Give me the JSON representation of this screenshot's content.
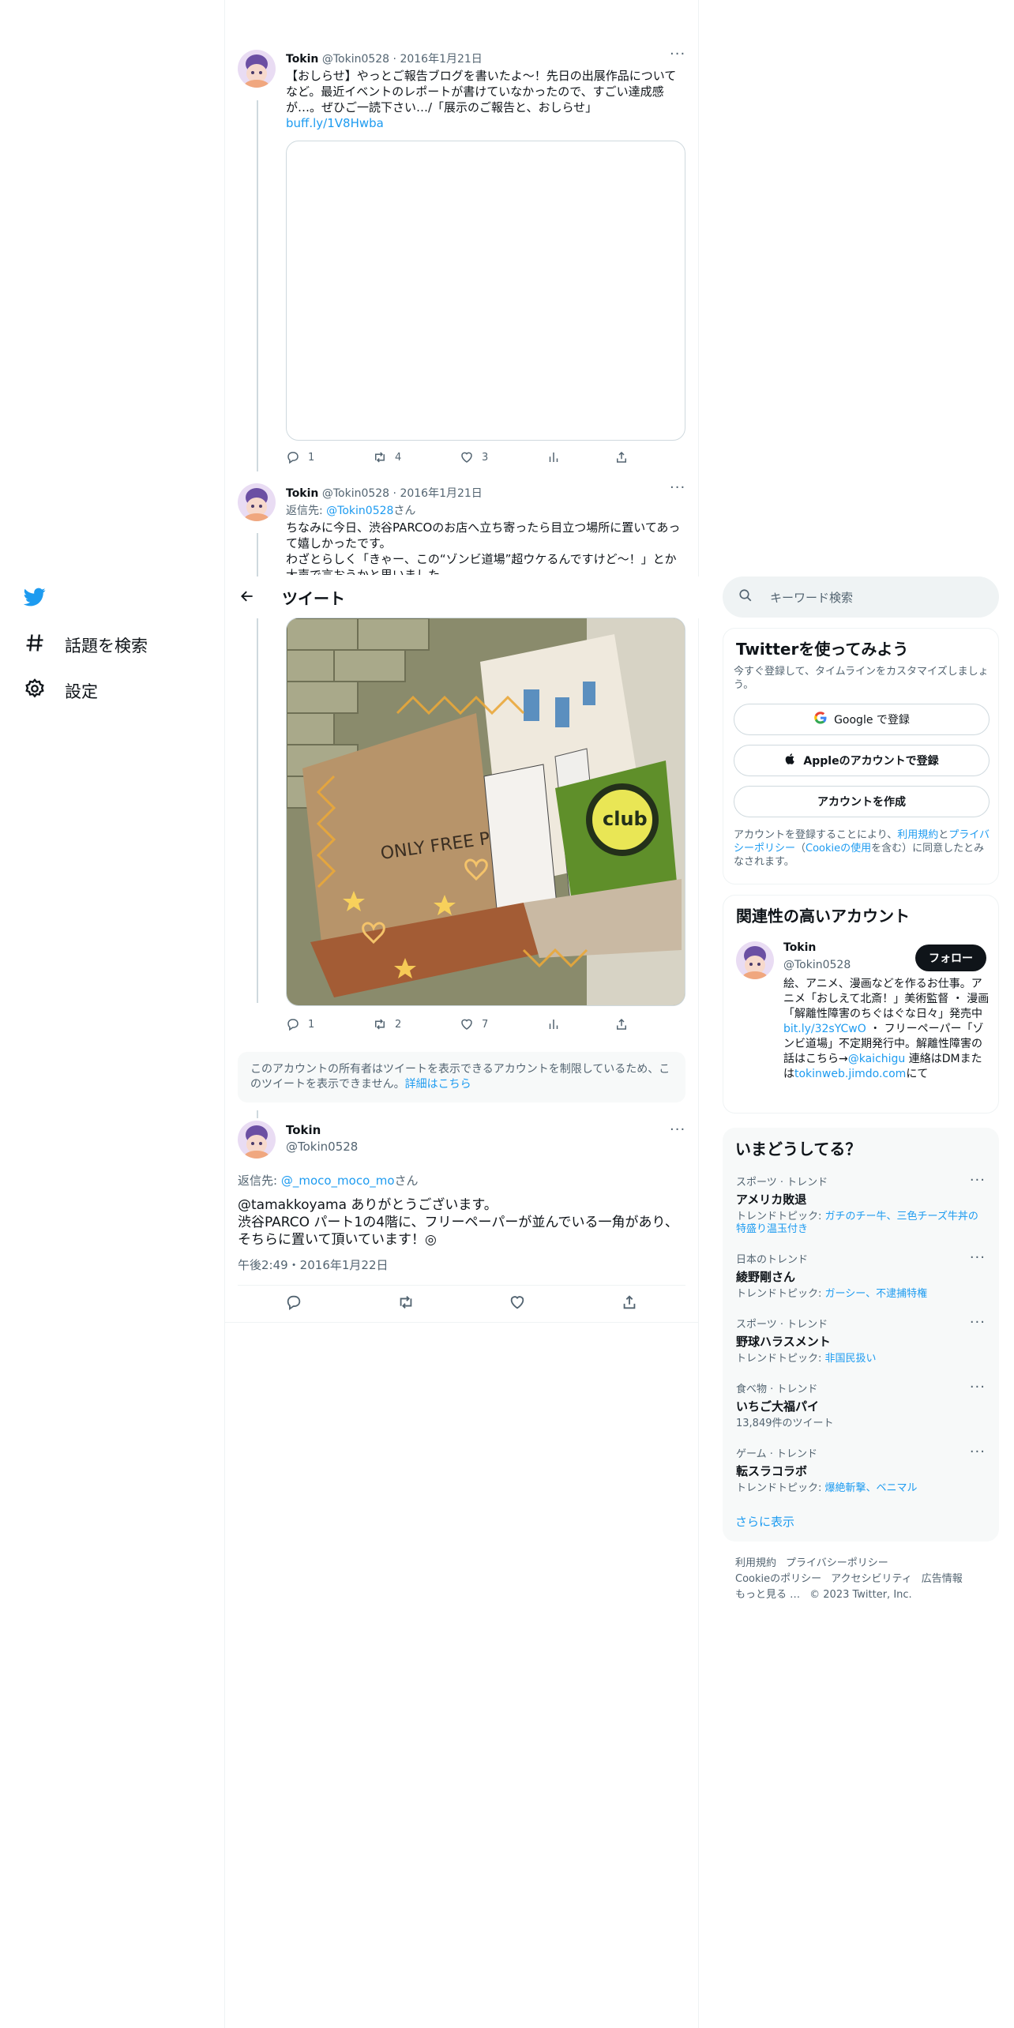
{
  "nav": {
    "explore_label": "話題を検索",
    "settings_label": "設定"
  },
  "header": {
    "title": "ツイート"
  },
  "tweet1": {
    "name": "Tokin",
    "handle": "@Tokin0528",
    "date": "2016年1月21日",
    "text": "【おしらせ】やっとご報告ブログを書いたよ～！先日の出展作品についてなど。最近イベントのレポートが書けていなかったので、すごい達成感が…。ぜひご一読下さい…/「展示のご報告と、おしらせ」",
    "link": "buff.ly/1V8Hwba",
    "replies": "1",
    "retweets": "4",
    "likes": "3"
  },
  "tweet2": {
    "name": "Tokin",
    "handle": "@Tokin0528",
    "date": "2016年1月21日",
    "reply_prefix": "返信先: ",
    "reply_to": "@Tokin0528",
    "reply_suffix": "さん",
    "text_line1": "ちなみに今日、渋谷PARCOのお店へ立ち寄ったら目立つ場所に置いてあって嬉しかったです。",
    "text_line2": "わざとらしく「きゃー、この“ゾンビ道場”超ウケるんですけど〜！」とか大声で言おうかと思いました。",
    "replies": "1",
    "retweets": "2",
    "likes": "7"
  },
  "restricted_notice": {
    "text": "このアカウントの所有者はツイートを表示できるアカウントを制限しているため、このツイートを表示できません。",
    "link": "詳細はこちら"
  },
  "main_tweet": {
    "name": "Tokin",
    "handle": "@Tokin0528",
    "reply_prefix": "返信先: ",
    "reply_to": "@_moco_moco_mo",
    "reply_suffix": "さん",
    "text_line1": "@tamakkoyama ありがとうございます。",
    "text_line2": "渋谷PARCO パート1の4階に、フリーペーパーが並んでいる一角があり、",
    "text_line3": "そちらに置いて頂いています！◎",
    "timestamp": "午後2:49・2016年1月22日"
  },
  "search": {
    "placeholder": "キーワード検索"
  },
  "signup": {
    "title": "Twitterを使ってみよう",
    "subtitle": "今すぐ登録して、タイムラインをカスタマイズしましょう。",
    "google_btn": "Google で登録",
    "apple_btn": "Appleのアカウントで登録",
    "create_btn": "アカウントを作成",
    "legal_prefix": "アカウントを登録することにより、",
    "legal_terms": "利用規約",
    "legal_and": "と",
    "legal_privacy": "プライバシーポリシー",
    "legal_paren_open": "（",
    "legal_cookie": "Cookieの使用",
    "legal_suffix": "を含む）に同意したとみなされます。"
  },
  "related": {
    "title": "関連性の高いアカウント",
    "name": "Tokin",
    "handle": "@Tokin0528",
    "follow_btn": "フォロー",
    "bio_line1": "絵、アニメ、漫画などを作るお仕事。アニメ「おしえて北斎！」美術監督 ・ 漫画「解離性障害のちぐはぐな日々」発売中 ",
    "bio_link1": "bit.ly/32sYCwO",
    "bio_line2": " ・ フリーペーパー「ゾンビ道場」不定期発行中。解離性障害の話はこちら→",
    "bio_link2": "@kaichigu",
    "bio_line3": " 連絡はDMまたは",
    "bio_link3": "tokinweb.jimdo.com",
    "bio_line4": "にて"
  },
  "trends": {
    "title": "いまどうしてる？",
    "items": [
      {
        "category": "スポーツ · トレンド",
        "title": "アメリカ敗退",
        "sub_prefix": "トレンドトピック: ",
        "sub_link": "ガチのチー牛、三色チーズ牛丼の特盛り温玉付き"
      },
      {
        "category": "日本のトレンド",
        "title": "綾野剛さん",
        "sub_prefix": "トレンドトピック: ",
        "sub_link": "ガーシー、不逮捕特権"
      },
      {
        "category": "スポーツ · トレンド",
        "title": "野球ハラスメント",
        "sub_prefix": "トレンドトピック: ",
        "sub_link": "非国民扱い"
      },
      {
        "category": "食べ物 · トレンド",
        "title": "いちご大福パイ",
        "sub_prefix": "13,849件のツイート",
        "sub_link": ""
      },
      {
        "category": "ゲーム · トレンド",
        "title": "転スラコラボ",
        "sub_prefix": "トレンドトピック: ",
        "sub_link": "爆絶斬撃、ベニマル"
      }
    ],
    "show_more": "さらに表示"
  },
  "footer": {
    "terms": "利用規約",
    "privacy": "プライバシーポリシー",
    "cookie": "Cookieのポリシー",
    "accessibility": "アクセシビリティ",
    "ads": "広告情報",
    "more": "もっと見る …",
    "copyright": "© 2023 Twitter, Inc."
  },
  "colors": {
    "accent": "#1d9bf0",
    "text": "#0f1419",
    "muted": "#536471"
  }
}
